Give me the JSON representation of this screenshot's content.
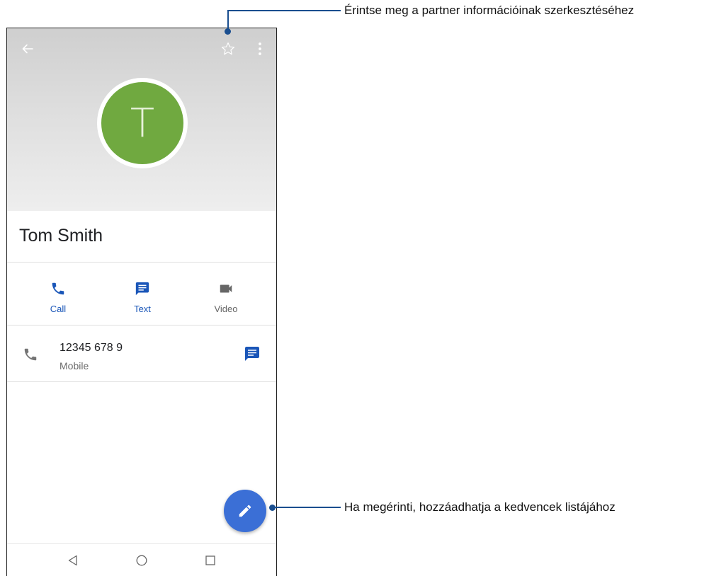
{
  "contact": {
    "initial": "T",
    "name": "Tom Smith"
  },
  "actions": [
    {
      "label": "Call",
      "icon": "phone-icon",
      "color": "#1a56b8"
    },
    {
      "label": "Text",
      "icon": "message-icon",
      "color": "#1a56b8"
    },
    {
      "label": "Video",
      "icon": "videocam-icon",
      "color": "#666666"
    }
  ],
  "phone_entry": {
    "number": "12345 678 9",
    "type": "Mobile"
  },
  "annotations": {
    "top": "Érintse meg a partner információinak szerkesztéséhez",
    "bottom": "Ha megérinti, hozzáadhatja a kedvencek listájához"
  },
  "colors": {
    "avatar": "#70a940",
    "fab": "#3b6fd6",
    "accent": "#1a56b8",
    "callout": "#1a4e8f"
  },
  "icons": {
    "back": "arrow-left-icon",
    "favorite": "star-outline-icon",
    "more": "more-vert-icon",
    "fab": "pencil-edit-icon",
    "nav": [
      "triangle-back-icon",
      "circle-home-icon",
      "square-recents-icon"
    ]
  }
}
